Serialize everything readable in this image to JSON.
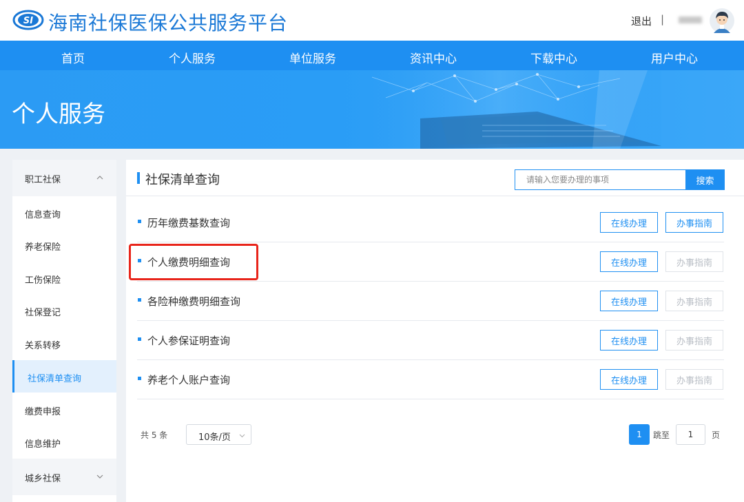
{
  "header": {
    "logo_text": "SI",
    "site_title": "海南社保医保公共服务平台",
    "logout": "退出",
    "separator": "|"
  },
  "nav": {
    "items": [
      "首页",
      "个人服务",
      "单位服务",
      "资讯中心",
      "下载中心",
      "用户中心"
    ]
  },
  "banner": {
    "title": "个人服务"
  },
  "sidebar": {
    "group_open": "职工社保",
    "items": [
      "信息查询",
      "养老保险",
      "工伤保险",
      "社保登记",
      "关系转移",
      "社保清单查询",
      "缴费申报",
      "信息维护"
    ],
    "active_item": "社保清单查询",
    "group_closed": "城乡社保"
  },
  "main": {
    "title": "社保清单查询",
    "search": {
      "placeholder": "请输入您要办理的事项",
      "button": "搜索"
    },
    "rows": [
      {
        "name": "历年缴费基数查询",
        "online": "在线办理",
        "guide": "办事指南",
        "guide_enabled": true
      },
      {
        "name": "个人缴费明细查询",
        "online": "在线办理",
        "guide": "办事指南",
        "guide_enabled": false,
        "highlighted": true
      },
      {
        "name": "各险种缴费明细查询",
        "online": "在线办理",
        "guide": "办事指南",
        "guide_enabled": false
      },
      {
        "name": "个人参保证明查询",
        "online": "在线办理",
        "guide": "办事指南",
        "guide_enabled": false
      },
      {
        "name": "养老个人账户查询",
        "online": "在线办理",
        "guide": "办事指南",
        "guide_enabled": false
      }
    ],
    "pagination": {
      "total": "共 5 条",
      "page_size": "10条/页",
      "current_page": "1",
      "goto_label": "跳至",
      "goto_value": "1",
      "page_unit": "页"
    }
  },
  "colors": {
    "primary": "#1e8ff2",
    "highlight": "#e8241a",
    "title": "#1a78d6"
  }
}
